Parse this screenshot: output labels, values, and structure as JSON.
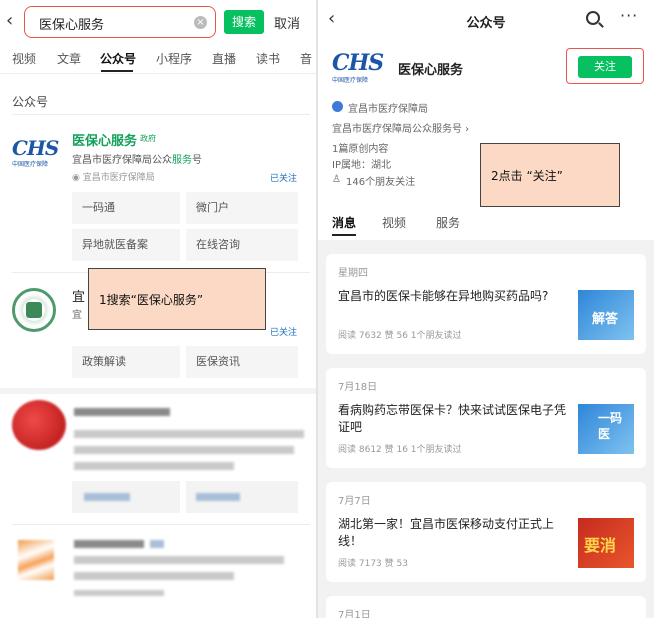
{
  "left": {
    "search": {
      "query": "医保心服务",
      "button_label": "搜索",
      "cancel_label": "取消"
    },
    "tabs": [
      "视频",
      "文章",
      "公众号",
      "小程序",
      "直播",
      "读书",
      "音"
    ],
    "section_label": "公众号",
    "results": [
      {
        "logo_text": "CHS",
        "logo_sub": "中国医疗保障",
        "title": "医保心服务",
        "tag": "政府",
        "desc_prefix": "宜昌市医疗保障局公众",
        "desc_highlight": "服务",
        "desc_suffix": "号",
        "auth": "宜昌市医疗保障局",
        "status": "已关注",
        "menus": [
          "一码通",
          "微门户",
          "异地就医备案",
          "在线咨询"
        ]
      },
      {
        "title": "宜",
        "subtitle": "宜",
        "status": "已关注",
        "menus": [
          "政策解读",
          "医保资讯"
        ]
      }
    ]
  },
  "annotations": {
    "step1": "1搜索“医保心服务”",
    "step2": "2点击 “关注”"
  },
  "right": {
    "title": "公众号",
    "account": {
      "logo_text": "CHS",
      "logo_sub": "中国医疗保障",
      "name": "医保心服务",
      "follow_label": "关注",
      "org": "宜昌市医疗保障局",
      "org_desc": "宜昌市医疗保障局公众服务号 ›",
      "original_count": "1篇原创内容",
      "ip_location": "IP属地：湖北",
      "friends_following": "146个朋友关注"
    },
    "tabs": [
      "消息",
      "视频",
      "服务"
    ],
    "posts": [
      {
        "date": "星期四",
        "title": "宜昌市的医保卡能够在异地购买药品吗?",
        "meta": "阅读 7632   赞 56   1个朋友读过",
        "thumb_text": "解答",
        "thumb_color": "#2e86d9"
      },
      {
        "date": "7月18日",
        "title": "看病购药忘带医保卡？快来试试医保电子凭证吧",
        "meta": "阅读 8612   赞 16   1个朋友读过",
        "thumb_text": "一码\n医",
        "thumb_color": "#2e86d9"
      },
      {
        "date": "7月7日",
        "title": "湖北第一家！宜昌市医保移动支付正式上线！",
        "meta": "阅读 7173   赞 53",
        "thumb_text": "要消",
        "thumb_color": "#c62a20"
      },
      {
        "date": "7月1日"
      }
    ]
  },
  "colors": {
    "accent_green": "#07c160",
    "link_green": "#13a05a",
    "brand_blue": "#1e56a7",
    "highlight_red": "#e8554e"
  }
}
